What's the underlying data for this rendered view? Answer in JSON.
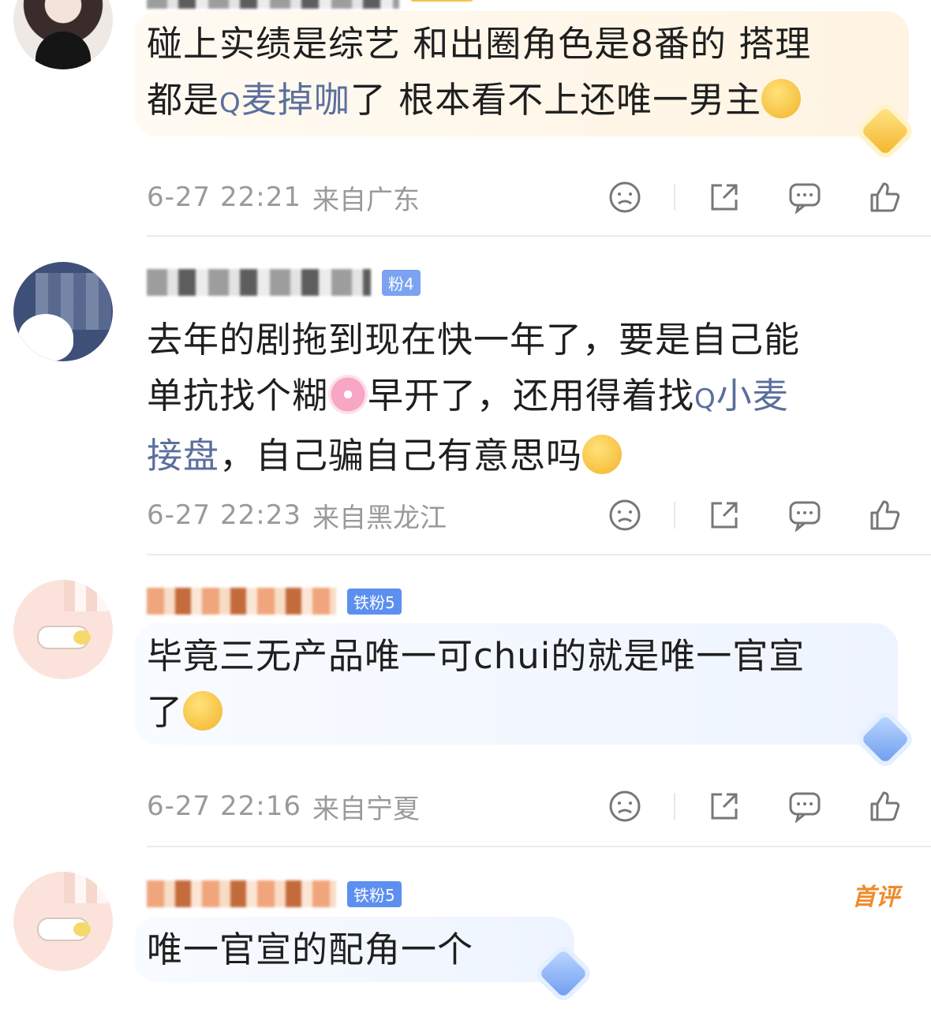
{
  "comments": [
    {
      "body_a": "碰上实绩是综艺 和出圈角色是8番的 搭理",
      "body_b_prefix": "都是",
      "search_icon": "Q",
      "body_b_link": "麦掉咖",
      "body_b_suffix": "了 根本看不上还唯一男主",
      "time": "6-27 22:21",
      "location": "来自广东"
    },
    {
      "fan_badge": "粉4",
      "line1": "去年的剧拖到现在快一年了，要是自己能",
      "line2_prefix": "单抗找个糊",
      "line2_mid": "早开了，还用得着找",
      "search_icon": "Q",
      "line2_link": "小麦",
      "line3_link": "接盘",
      "line3_suffix": "，自己骗自己有意思吗",
      "time": "6-27 22:23",
      "location": "来自黑龙江"
    },
    {
      "fan_badge": "铁粉5",
      "line1": "毕竟三无产品唯一可chui的就是唯一官宣",
      "line2": "了",
      "time": "6-27 22:16",
      "location": "来自宁夏"
    },
    {
      "fan_badge": "铁粉5",
      "first_pick": "首评",
      "line1": "唯一官宣的配角一个"
    }
  ],
  "icons": [
    "dislike-icon",
    "share-icon",
    "comment-icon",
    "like-icon"
  ],
  "colors": {
    "link": "#5b6f9c",
    "meta": "#9a9a9a",
    "first_pick": "#f08a2c"
  }
}
